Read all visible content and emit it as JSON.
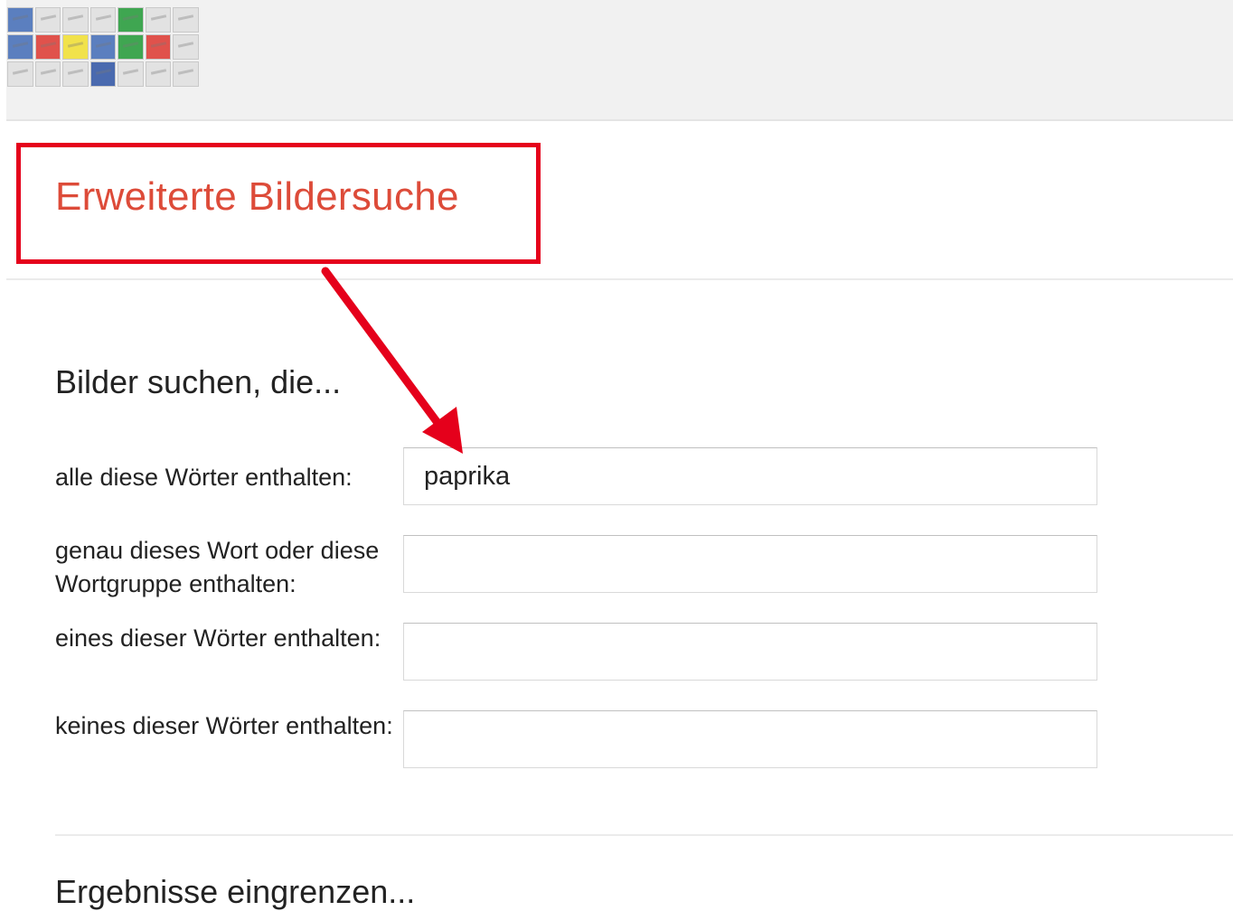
{
  "header": {
    "logo_icon": "image-thumbnails-logo",
    "logo_cells": [
      "#5b7fbf",
      "#e2e2e2",
      "#e2e2e2",
      "#e2e2e2",
      "#3fa651",
      "#e2e2e2",
      "#e2e2e2",
      "#5b7fbf",
      "#e0524c",
      "#f1e24b",
      "#5b7fbf",
      "#3fa651",
      "#e0524c",
      "#e2e2e2",
      "#e2e2e2",
      "#e2e2e2",
      "#e2e2e2",
      "#4a6aaf",
      "#e2e2e2",
      "#e2e2e2",
      "#e2e2e2"
    ]
  },
  "title": {
    "text": "Erweiterte Bildersuche",
    "highlight_color": "#e5001b",
    "title_color": "#dd4b39"
  },
  "find_section": {
    "heading": "Bilder suchen, die...",
    "fields": [
      {
        "label": "alle diese Wörter enthalten:",
        "value": "paprika",
        "placeholder": ""
      },
      {
        "label": "genau dieses Wort oder diese Wortgruppe enthalten:",
        "value": "",
        "placeholder": ""
      },
      {
        "label": "eines dieser Wörter enthalten:",
        "value": "",
        "placeholder": ""
      },
      {
        "label": "keines dieser Wörter enthalten:",
        "value": "",
        "placeholder": ""
      }
    ]
  },
  "narrow_section": {
    "heading": "Ergebnisse eingrenzen..."
  },
  "annotation": {
    "arrow_color": "#e5001b",
    "arrow_icon": "red-arrow-annotation"
  }
}
